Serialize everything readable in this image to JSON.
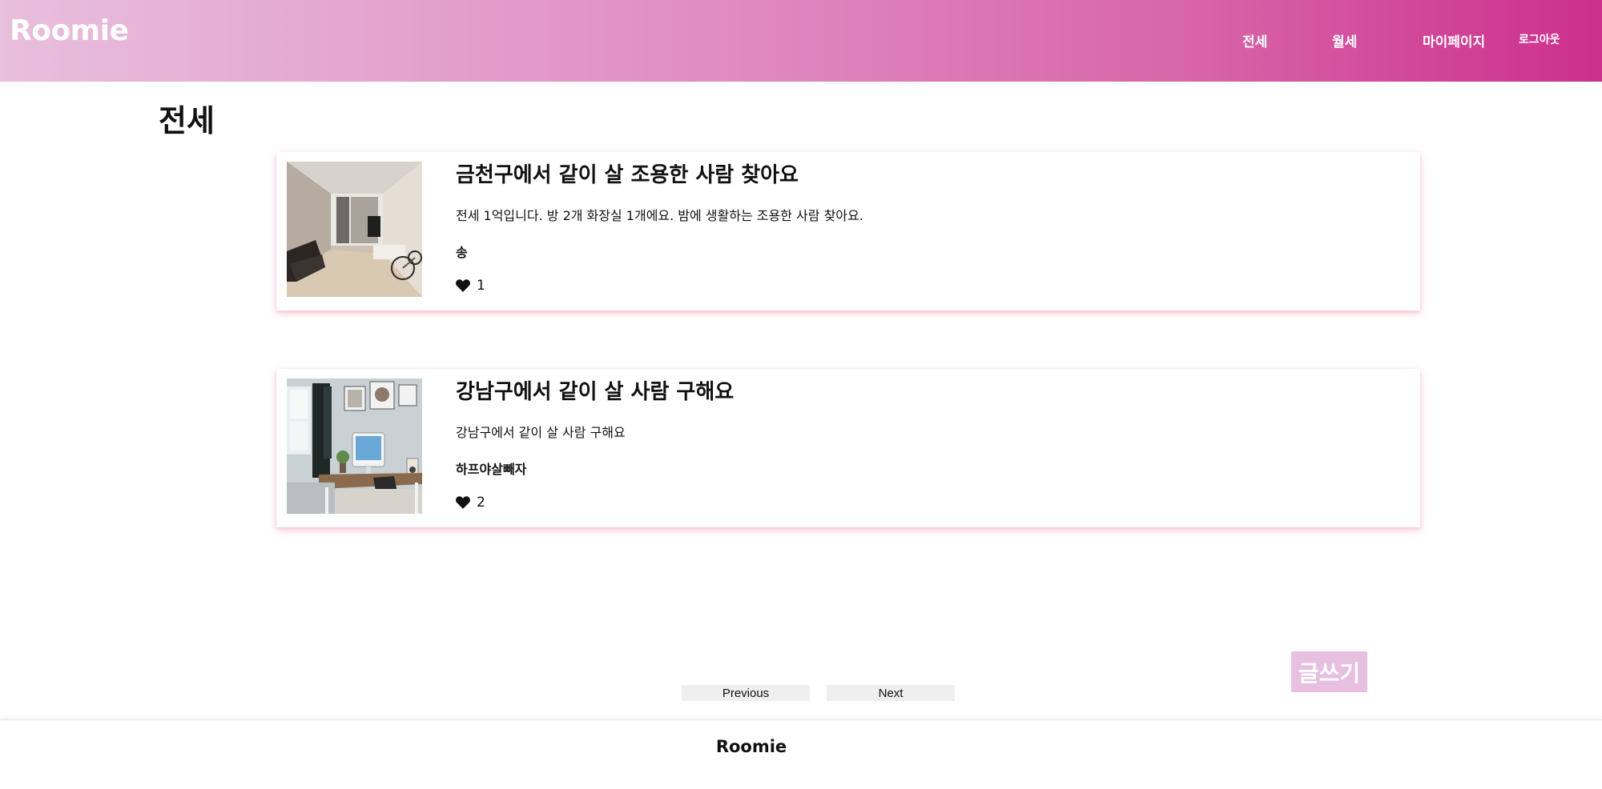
{
  "header": {
    "logo": "Roomie",
    "nav": {
      "jeonse": "전세",
      "wolse": "월세",
      "mypage": "마이페이지",
      "logout": "로그아웃"
    }
  },
  "main": {
    "title": "전세",
    "posts": [
      {
        "title": "금천구에서 같이 살 조용한 사람 찾아요",
        "description": "전세 1억입니다. 방 2개 화장실 1개에요. 밤에 생활하는 조용한 사람 찾아요.",
        "author": "송",
        "likes": "1"
      },
      {
        "title": "강남구에서 같이 살 사람 구해요",
        "description": "강남구에서 같이 살 사람 구해요",
        "author": "하프야살빼자",
        "likes": "2"
      }
    ],
    "write_button": "글쓰기",
    "pagination": {
      "previous": "Previous",
      "next": "Next"
    }
  },
  "footer": {
    "logo": "Roomie"
  },
  "colors": {
    "header_gradient_start": "#e8bfdd",
    "header_gradient_end": "#cc2f8c",
    "write_button": "#e7bfe0"
  },
  "icons": {
    "like": "heart-icon"
  }
}
